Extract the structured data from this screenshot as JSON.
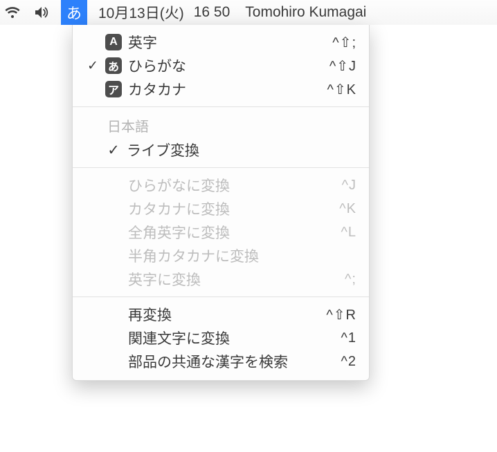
{
  "menubar": {
    "ime_indicator": "あ",
    "date": "10月13日(火)",
    "time": "16 50",
    "user": "Tomohiro Kumagai"
  },
  "menu": {
    "input_modes": [
      {
        "checked": false,
        "badge": "A",
        "label": "英字",
        "shortcut": "^⇧;"
      },
      {
        "checked": true,
        "badge": "あ",
        "label": "ひらがな",
        "shortcut": "^⇧J"
      },
      {
        "checked": false,
        "badge": "ア",
        "label": "カタカナ",
        "shortcut": "^⇧K"
      }
    ],
    "section_japanese": "日本語",
    "live_conversion": {
      "checked": true,
      "label": "ライブ変換"
    },
    "conversions": [
      {
        "label": "ひらがなに変換",
        "shortcut": "^J"
      },
      {
        "label": "カタカナに変換",
        "shortcut": "^K"
      },
      {
        "label": "全角英字に変換",
        "shortcut": "^L"
      },
      {
        "label": "半角カタカナに変換",
        "shortcut": ""
      },
      {
        "label": "英字に変換",
        "shortcut": "^;"
      }
    ],
    "actions": [
      {
        "label": "再変換",
        "shortcut": "^⇧R"
      },
      {
        "label": "関連文字に変換",
        "shortcut": "^1"
      },
      {
        "label": "部品の共通な漢字を検索",
        "shortcut": "^2"
      }
    ]
  }
}
